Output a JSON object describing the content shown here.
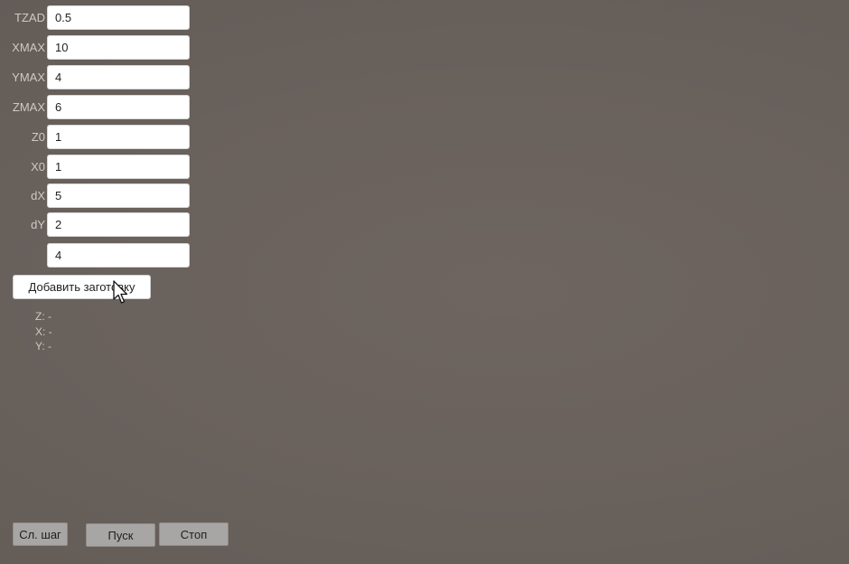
{
  "fields": [
    {
      "label": "TZAD",
      "value": "0.5"
    },
    {
      "label": "XMAX",
      "value": "10"
    },
    {
      "label": "YMAX",
      "value": "4"
    },
    {
      "label": "ZMAX",
      "value": "6"
    },
    {
      "label": "Z0",
      "value": "1"
    },
    {
      "label": "X0",
      "value": "1"
    },
    {
      "label": "dX",
      "value": "5"
    },
    {
      "label": "dY",
      "value": "2"
    },
    {
      "label": "",
      "value": "4"
    }
  ],
  "add_blank_button": "Добавить заготовку",
  "coordinates": {
    "z": "Z: -",
    "x": "X: -",
    "y": "Y: -"
  },
  "controls": {
    "step": "Сл. шаг",
    "start": "Пуск",
    "stop": "Стоп"
  },
  "icons": {
    "cursor": "mouse-pointer-icon"
  },
  "colors": {
    "background": "#69615c",
    "label_text": "#cfc9c4",
    "control_button": "#a8a6a4"
  }
}
